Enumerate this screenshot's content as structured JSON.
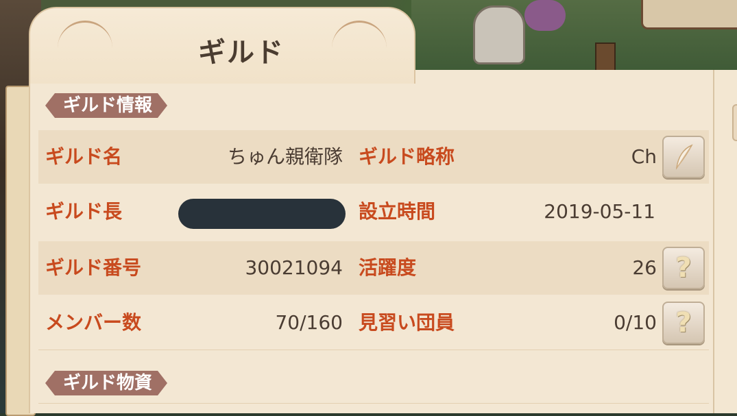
{
  "window": {
    "title": "ギルド"
  },
  "sections": {
    "info_label": "ギルド情報",
    "resources_label": "ギルド物資"
  },
  "guild_info": {
    "name_label": "ギルド名",
    "name_value": "ちゅん親衛隊",
    "abbr_label": "ギルド略称",
    "abbr_value": "Ch",
    "leader_label": "ギルド長",
    "founded_label": "設立時間",
    "founded_value": "2019-05-11",
    "number_label": "ギルド番号",
    "number_value": "30021094",
    "activity_label": "活躍度",
    "activity_value": "26",
    "members_label": "メンバー数",
    "members_value": "70/160",
    "trainees_label": "見習い団員",
    "trainees_value": "0/10"
  },
  "icons": {
    "edit": "feather-quill-icon",
    "help": "question-icon",
    "help_glyph": "?"
  },
  "colors": {
    "label": "#c84a1e",
    "value": "#4a3c32",
    "panel": "#f3e7d3",
    "section_badge": "#a07065"
  }
}
